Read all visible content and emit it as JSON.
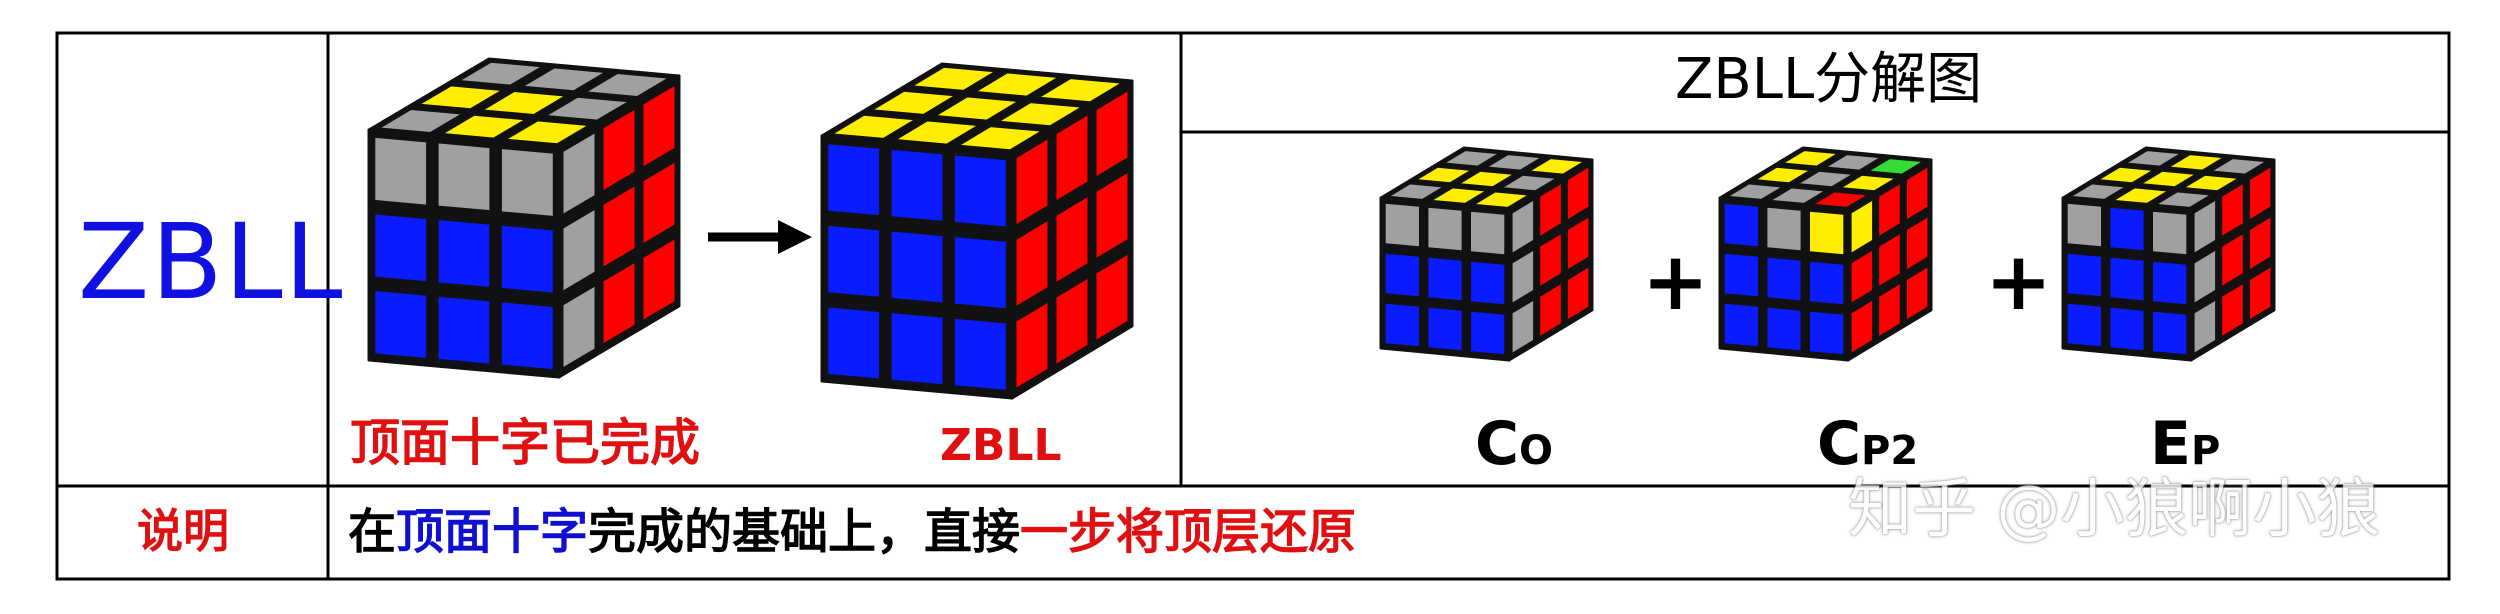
{
  "title": "ZBLL",
  "diagram": {
    "before_label": "顶面十字已完成",
    "after_label": "ZBLL",
    "decomposition_title": "ZBLL分解图",
    "parts": [
      {
        "main": "C",
        "sub": "O"
      },
      {
        "main": "C",
        "sub": "P2"
      },
      {
        "main": "E",
        "sub": "P"
      }
    ],
    "operators": [
      "+",
      "+"
    ]
  },
  "explanation": {
    "label": "说明",
    "segments": [
      {
        "text": "在",
        "color": "#000000"
      },
      {
        "text": "顶面十字",
        "color": "#1010d0"
      },
      {
        "text": "完成的基础上，直接",
        "color": "#000000"
      },
      {
        "text": "一步将顶层还原",
        "color": "#e01010"
      }
    ]
  },
  "watermark": "知乎 @小狼啊小狼",
  "colors": {
    "title_blue": "#1010e0",
    "label_red": "#e01010",
    "yellow": "#ffee00",
    "blue": "#0a1cff",
    "red": "#ff0000",
    "gray": "#a0a0a0",
    "green": "#33dd33"
  }
}
